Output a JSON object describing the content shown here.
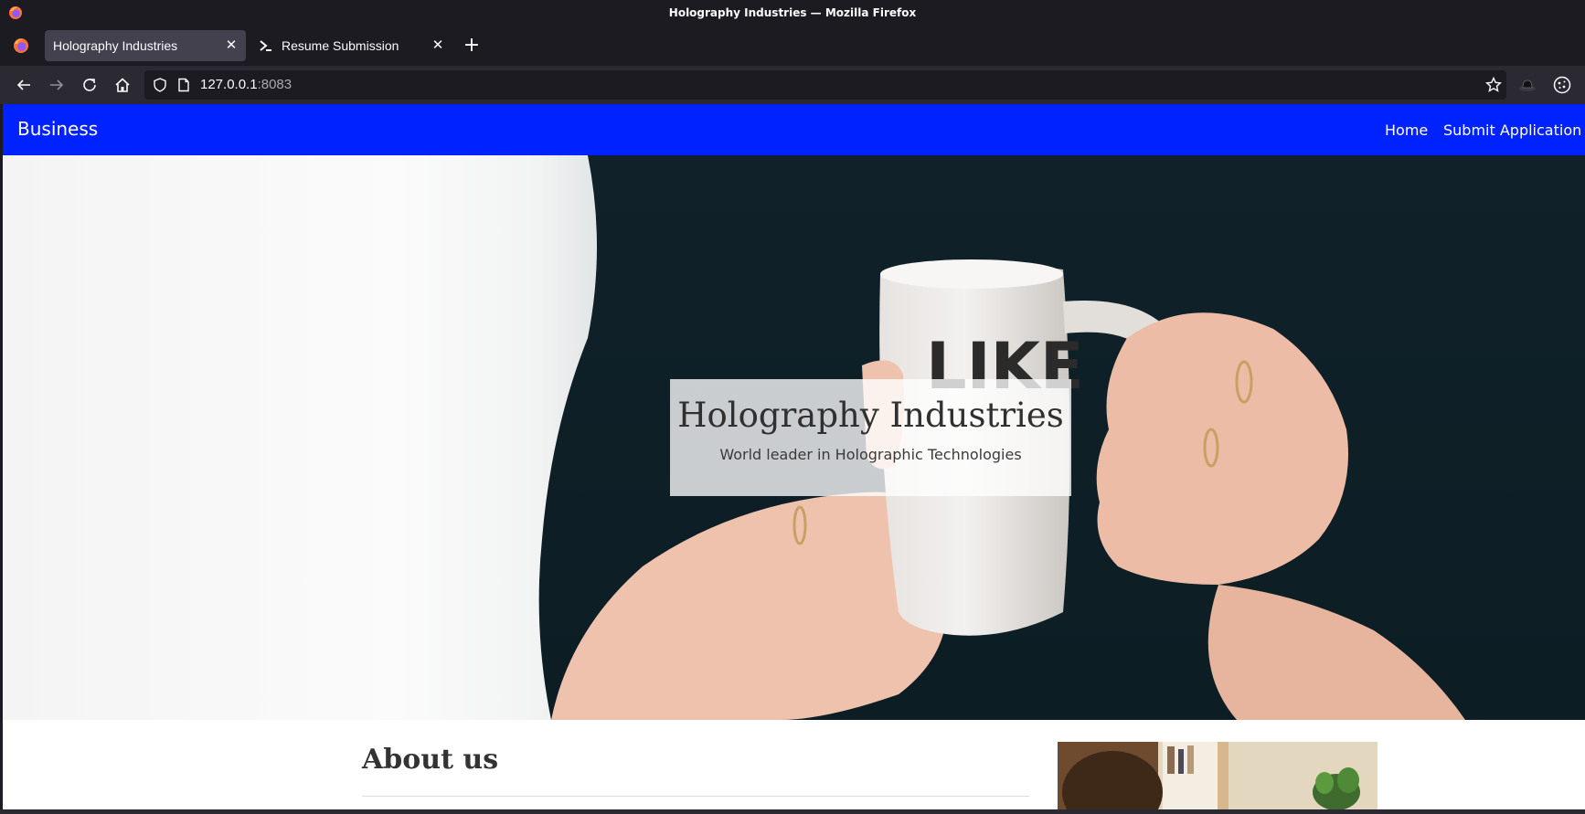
{
  "window": {
    "title": "Holography Industries — Mozilla Firefox"
  },
  "tabs": [
    {
      "label": "Holography Industries",
      "active": true
    },
    {
      "label": "Resume Submission",
      "active": false
    }
  ],
  "urlbar": {
    "host": "127.0.0.1",
    "port": ":8083"
  },
  "site": {
    "brand": "Business",
    "nav": [
      {
        "label": "Home"
      },
      {
        "label": "Submit Application"
      }
    ],
    "nav_color": "#0022ff"
  },
  "hero": {
    "title": "Holography Industries",
    "subtitle": "World leader in Holographic Technologies",
    "mug_text": "LIKE"
  },
  "about": {
    "title": "About us"
  },
  "colors": {
    "chrome_dark": "#1c1b22",
    "chrome_mid": "#2b2a33",
    "tab_active": "#42414d"
  }
}
